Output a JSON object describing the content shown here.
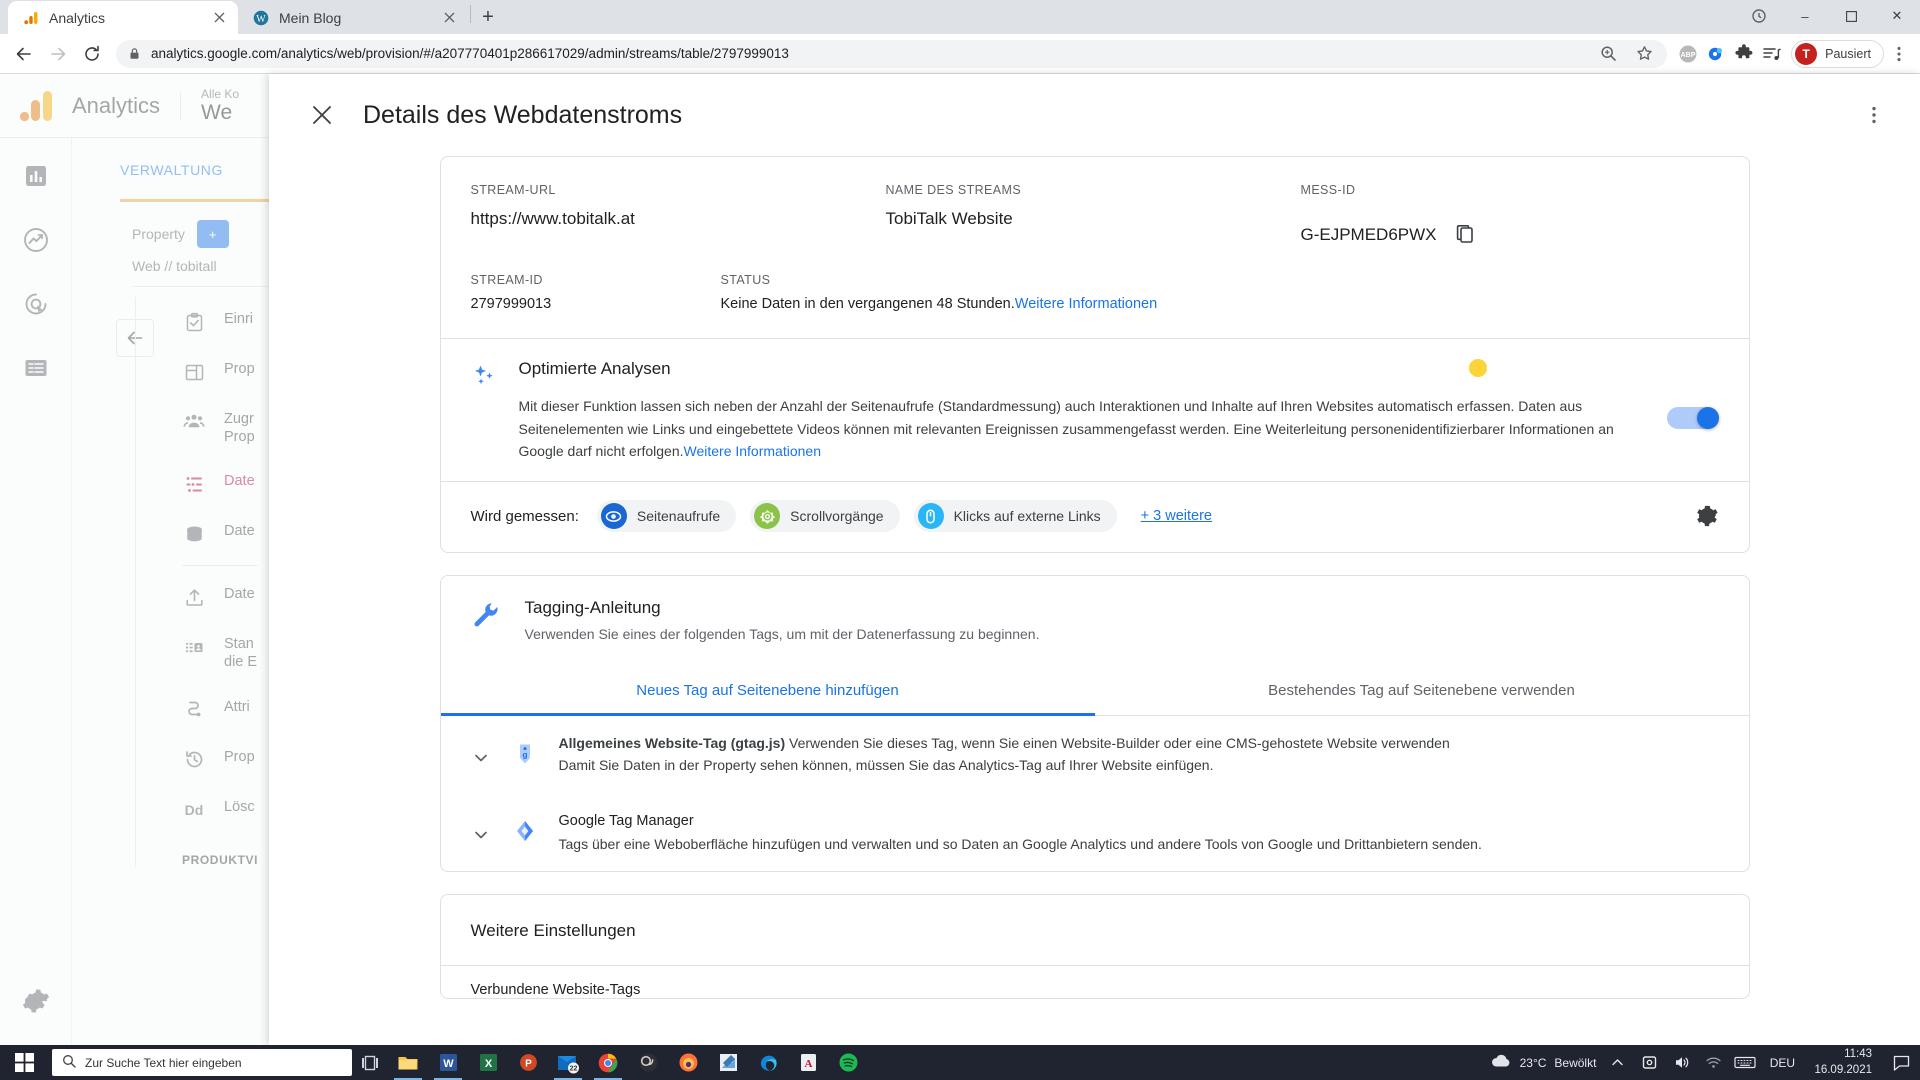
{
  "browser": {
    "tabs": [
      {
        "title": "Analytics",
        "favicon": "analytics-icon",
        "active": true
      },
      {
        "title": "Mein Blog",
        "favicon": "wordpress-icon",
        "active": false
      }
    ],
    "new_tab_label": "+",
    "window_controls": {
      "minimize": "–",
      "maximize": "☐",
      "close": "✕"
    },
    "url": "analytics.google.com/analytics/web/provision/#/a207770401p286617029/admin/streams/table/2797999013",
    "nav": {
      "back": "←",
      "forward": "→",
      "reload": "⟳"
    },
    "toolbar_icons": [
      "zoom-icon",
      "bookmark-star-icon",
      "adblock-icon",
      "extension-icon",
      "puzzle-icon",
      "reading-list-icon"
    ],
    "profile": {
      "initial": "T",
      "label": "Pausiert"
    },
    "menu_icon": "kebab-menu-icon"
  },
  "analytics": {
    "brand": "Analytics",
    "account_small": "Alle Ko",
    "account_big": "We",
    "tab_label": "VERWALTUNG",
    "property_label": "Property",
    "property_button": "+",
    "property_sub": "Web // tobitall",
    "menu": [
      {
        "label": "Einri",
        "icon": "clipboard-check-icon",
        "active": false
      },
      {
        "label": "Prop",
        "icon": "layout-icon",
        "active": false
      },
      {
        "label": "Zugr\nProp",
        "icon": "people-icon",
        "active": false
      },
      {
        "label": "Date",
        "icon": "data-streams-icon",
        "active": true
      },
      {
        "label": "Date",
        "icon": "database-icon",
        "active": false
      },
      {
        "label": "Date",
        "icon": "upload-icon",
        "active": false
      },
      {
        "label": "Stan\ndie E",
        "icon": "identity-icon",
        "active": false
      },
      {
        "label": "Attri",
        "icon": "attribution-icon",
        "active": false
      },
      {
        "label": "Prop",
        "icon": "history-icon",
        "active": false
      },
      {
        "label": "Lösc",
        "icon": "dd-icon",
        "active": false
      }
    ],
    "menu_section": "PRODUKTVI",
    "rail_icons": [
      "home-chart-icon",
      "realtime-icon",
      "explore-icon",
      "reports-list-icon",
      "settings-gear-icon"
    ]
  },
  "overlay": {
    "close_icon": "close-icon",
    "title": "Details des Webdatenstroms",
    "more_icon": "kebab-menu-icon",
    "stream": {
      "url_label": "STREAM-URL",
      "url_value": "https://www.tobitalk.at",
      "name_label": "NAME DES STREAMS",
      "name_value": "TobiTalk Website",
      "mess_label": "MESS-ID",
      "mess_value": "G-EJPMED6PWX",
      "copy_icon": "copy-icon",
      "id_label": "STREAM-ID",
      "id_value": "2797999013",
      "status_label": "STATUS",
      "status_value": "Keine Daten in den vergangenen 48 Stunden.",
      "status_link": "Weitere Informationen"
    },
    "enhanced": {
      "icon": "sparkle-icon",
      "title": "Optimierte Analysen",
      "desc_line1": "Mit dieser Funktion lassen sich neben der Anzahl der Seitenaufrufe (Standardmessung) auch Interaktionen und Inhalte auf Ihren Websites automatisch erfassen.",
      "desc_line2": "Daten aus Seitenelementen wie Links und eingebettete Videos können mit relevanten Ereignissen zusammengefasst werden. Eine Weiterleitung",
      "desc_line3": "personenidentifizierbarer Informationen an Google darf nicht erfolgen.",
      "desc_link": "Weitere Informationen",
      "toggle_on": true,
      "measured_label": "Wird gemessen:",
      "chips": [
        {
          "label": "Seitenaufrufe",
          "icon": "eye-icon",
          "color": "#1967d2"
        },
        {
          "label": "Scrollvorgänge",
          "icon": "scroll-target-icon",
          "color": "#8bc34a"
        },
        {
          "label": "Klicks auf externe Links",
          "icon": "mouse-click-icon",
          "color": "#29b6f6"
        }
      ],
      "more_label": "+ 3 weitere",
      "gear_icon": "gear-icon"
    },
    "tagging": {
      "icon": "wrench-icon",
      "title": "Tagging-Anleitung",
      "subtitle": "Verwenden Sie eines der folgenden Tags, um mit der Datenerfassung zu beginnen.",
      "tabs": [
        {
          "label": "Neues Tag auf Seitenebene hinzufügen",
          "active": true
        },
        {
          "label": "Bestehendes Tag auf Seitenebene verwenden",
          "active": false
        }
      ],
      "rows": [
        {
          "icon": "gtag-icon",
          "chevron": "chevron-down-icon",
          "title_bold": "Allgemeines Website-Tag (gtag.js)",
          "title_rest": " Verwenden Sie dieses Tag, wenn Sie einen Website-Builder oder eine CMS-gehostete Website verwenden",
          "desc": "Damit Sie Daten in der Property sehen können, müssen Sie das Analytics-Tag auf Ihrer Website einfügen."
        },
        {
          "icon": "tag-manager-icon",
          "chevron": "chevron-down-icon",
          "title_bold": "Google Tag Manager",
          "title_rest": "",
          "desc": "Tags über eine Weboberfläche hinzufügen und verwalten und so Daten an Google Analytics und andere Tools von Google und Drittanbietern senden."
        }
      ]
    },
    "more_settings": {
      "title": "Weitere Einstellungen",
      "item": "Verbundene Website-Tags"
    }
  },
  "taskbar": {
    "start_icon": "windows-start-icon",
    "search_placeholder": "Zur Suche Text hier eingeben",
    "search_icon": "search-icon",
    "taskview_icon": "task-view-icon",
    "apps": [
      {
        "name": "file-explorer-icon",
        "running": true
      },
      {
        "name": "word-icon",
        "running": true
      },
      {
        "name": "excel-icon",
        "running": false
      },
      {
        "name": "powerpoint-icon",
        "running": false
      },
      {
        "name": "outlook-icon",
        "badge": "22",
        "running": true
      },
      {
        "name": "chrome-icon",
        "running": true
      },
      {
        "name": "obs-icon",
        "running": false
      },
      {
        "name": "firefox-icon",
        "running": false
      },
      {
        "name": "paint-icon",
        "running": false
      },
      {
        "name": "edge-icon",
        "running": false
      },
      {
        "name": "acrobat-icon",
        "running": false
      },
      {
        "name": "spotify-icon",
        "running": false
      }
    ],
    "weather_temp": "23°C",
    "weather_text": "Bewölkt",
    "tray_icons": [
      "chevron-up-icon",
      "onedrive-icon",
      "volume-icon",
      "wifi-icon",
      "keyboard-icon"
    ],
    "language": "DEU",
    "time": "11:43",
    "date": "16.09.2021",
    "notification_icon": "notification-icon"
  }
}
